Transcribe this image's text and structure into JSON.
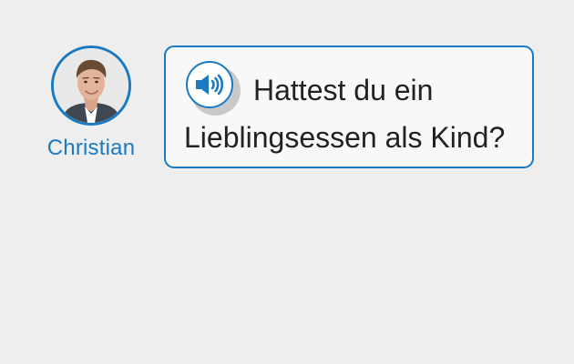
{
  "speaker": {
    "name": "Christian",
    "avatar_icon": "person-photo",
    "accent_color": "#1b7ac2"
  },
  "bubble": {
    "audio_icon": "speaker-volume-icon",
    "text": "Hattest du ein Lieblingsessen als Kind?"
  }
}
